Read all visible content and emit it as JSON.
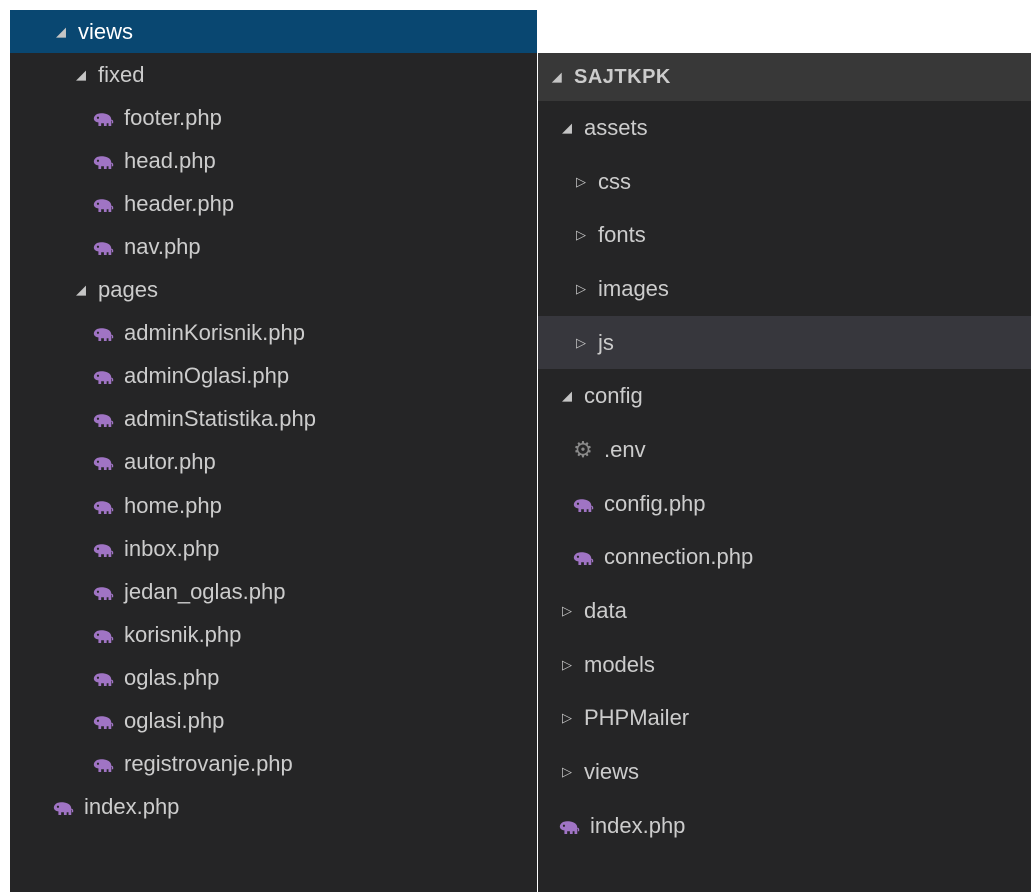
{
  "left_explorer": {
    "items": [
      {
        "label": "views",
        "type": "folder",
        "expanded": true,
        "depth": 0,
        "selected": true
      },
      {
        "label": "fixed",
        "type": "folder",
        "expanded": true,
        "depth": 1
      },
      {
        "label": "footer.php",
        "type": "php",
        "depth": 2
      },
      {
        "label": "head.php",
        "type": "php",
        "depth": 2
      },
      {
        "label": "header.php",
        "type": "php",
        "depth": 2
      },
      {
        "label": "nav.php",
        "type": "php",
        "depth": 2
      },
      {
        "label": "pages",
        "type": "folder",
        "expanded": true,
        "depth": 1
      },
      {
        "label": "adminKorisnik.php",
        "type": "php",
        "depth": 2
      },
      {
        "label": "adminOglasi.php",
        "type": "php",
        "depth": 2
      },
      {
        "label": "adminStatistika.php",
        "type": "php",
        "depth": 2
      },
      {
        "label": "autor.php",
        "type": "php",
        "depth": 2
      },
      {
        "label": "home.php",
        "type": "php",
        "depth": 2
      },
      {
        "label": "inbox.php",
        "type": "php",
        "depth": 2
      },
      {
        "label": "jedan_oglas.php",
        "type": "php",
        "depth": 2
      },
      {
        "label": "korisnik.php",
        "type": "php",
        "depth": 2
      },
      {
        "label": "oglas.php",
        "type": "php",
        "depth": 2
      },
      {
        "label": "oglasi.php",
        "type": "php",
        "depth": 2
      },
      {
        "label": "registrovanje.php",
        "type": "php",
        "depth": 2
      },
      {
        "label": "index.php",
        "type": "php",
        "depth": 0
      }
    ]
  },
  "right_explorer": {
    "root_label": "SAJTKPK",
    "items": [
      {
        "label": "assets",
        "type": "folder",
        "expanded": true,
        "depth": 1
      },
      {
        "label": "css",
        "type": "folder",
        "expanded": false,
        "depth": 2
      },
      {
        "label": "fonts",
        "type": "folder",
        "expanded": false,
        "depth": 2
      },
      {
        "label": "images",
        "type": "folder",
        "expanded": false,
        "depth": 2
      },
      {
        "label": "js",
        "type": "folder",
        "expanded": false,
        "depth": 2,
        "hover": true
      },
      {
        "label": "config",
        "type": "folder",
        "expanded": true,
        "depth": 1
      },
      {
        "label": ".env",
        "type": "env",
        "depth": 2
      },
      {
        "label": "config.php",
        "type": "php",
        "depth": 2
      },
      {
        "label": "connection.php",
        "type": "php",
        "depth": 2
      },
      {
        "label": "data",
        "type": "folder",
        "expanded": false,
        "depth": 1
      },
      {
        "label": "models",
        "type": "folder",
        "expanded": false,
        "depth": 1
      },
      {
        "label": "PHPMailer",
        "type": "folder",
        "expanded": false,
        "depth": 1
      },
      {
        "label": "views",
        "type": "folder",
        "expanded": false,
        "depth": 1
      },
      {
        "label": "index.php",
        "type": "php",
        "depth": 1
      }
    ]
  },
  "icons": {
    "expanded": "triangle-expanded-icon",
    "collapsed": "triangle-collapsed-icon",
    "php": "php-elephant-icon",
    "env": "gear-icon"
  },
  "colors": {
    "sidebar_bg": "#252526",
    "header_bg": "#383838",
    "selected_bg": "#094771",
    "hover_bg": "#37373d",
    "text": "#cccccc",
    "php_icon": "#a074c4",
    "gear_icon": "#8a8a8a"
  }
}
